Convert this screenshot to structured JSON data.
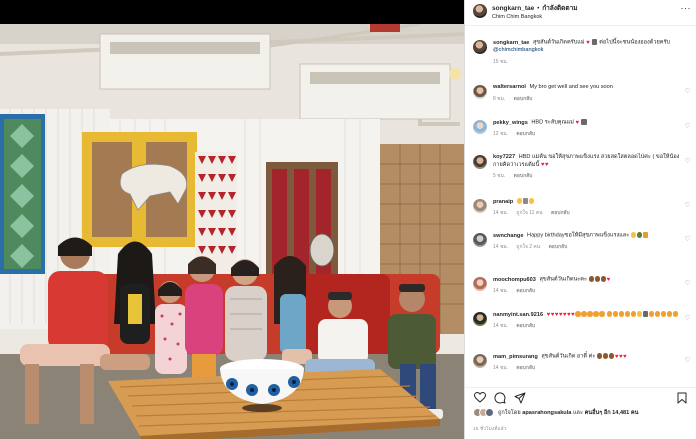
{
  "post": {
    "username": "songkarn_tae",
    "separator": "•",
    "follow_label": "กำลังติดตาม",
    "location": "Chim Chim Bangkok",
    "more": "···"
  },
  "comments": [
    {
      "username": "songkarn_tae",
      "text": "สุขสันต์วันเกิดครับแม่",
      "tail": "ต่อไปนี้จะชนน้องอองด้วยครับ",
      "mention": "@chimchimbangkok",
      "time": "15 ชม.",
      "likes": "",
      "reply": ""
    },
    {
      "username": "waltersarnoi",
      "text": "My bro get well and see you soon",
      "time": "8 ชม.",
      "likes": "",
      "reply": "ตอบกลับ"
    },
    {
      "username": "pekky_wings",
      "text": "HBD ระลับคุณแม่",
      "time": "12 ชม.",
      "likes": "",
      "reply": "ตอบกลับ"
    },
    {
      "username": "koy7227",
      "text": "HBD แม่ต้น ขอให้สุขภาพแข็งแรง สวยสดใสตลอดไปค่ะ ( ขอให้น้องกายคิดว่าเวรแต้มนี้",
      "time": "5 ชม.",
      "likes": "",
      "reply": "ตอบกลับ"
    },
    {
      "username": "pranaip",
      "text": "",
      "time": "14 ชม.",
      "likes": "ถูกใจ 11 คน",
      "reply": "ตอบกลับ"
    },
    {
      "username": "swnchange",
      "text": "Happy birthdayขอให้มีสุขภาพแข็งแรงและ",
      "time": "14 ชม.",
      "likes": "ถูกใจ 2 คน",
      "reply": "ตอบกลับ"
    },
    {
      "username": "moochompu603",
      "text": "สุขสันต์วันเกิดนะคะ",
      "time": "14 ชม.",
      "likes": "",
      "reply": "ตอบกลับ"
    },
    {
      "username": "nanmyint.san.9216",
      "text": "",
      "time": "14 ชม.",
      "likes": "",
      "reply": "ตอบกลับ"
    },
    {
      "username": "mam_pimsurang",
      "text": "สุขสันต์วันเกิด อาตี๋ ค่ะ",
      "time": "14 ชม.",
      "likes": "",
      "reply": "ตอบกลับ"
    }
  ],
  "likes": {
    "prefix": "ถูกใจโดย",
    "user": "apasrahongsakula",
    "and": "และ",
    "others": "คนอื่นๆ อีก 14,481 คน"
  },
  "time_ago": "15 ชั่วโมงที่แล้ว",
  "colors": {
    "heart": "#ed1d3b",
    "mention": "#00376b",
    "meta": "#8e8e8e"
  },
  "icons": [
    "more-icon",
    "heart-icon",
    "comment-icon",
    "share-icon",
    "bookmark-icon"
  ]
}
